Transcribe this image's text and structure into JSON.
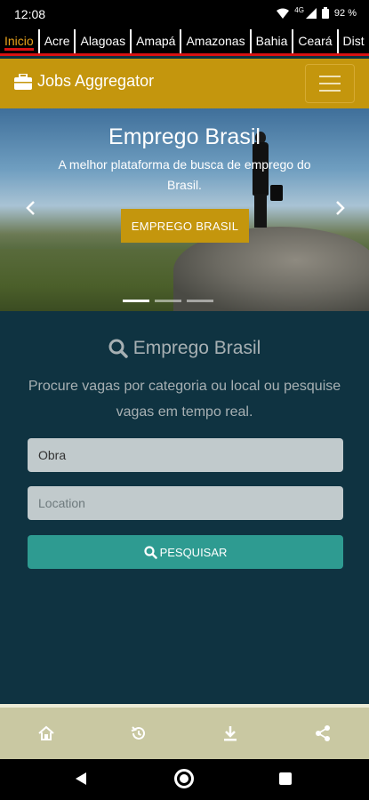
{
  "status_bar": {
    "time": "12:08",
    "network": "4G",
    "battery": "92 %"
  },
  "tabs": [
    {
      "label": "Inicio",
      "active": true
    },
    {
      "label": "Acre",
      "active": false
    },
    {
      "label": "Alagoas",
      "active": false
    },
    {
      "label": "Amapá",
      "active": false
    },
    {
      "label": "Amazonas",
      "active": false
    },
    {
      "label": "Bahia",
      "active": false
    },
    {
      "label": "Ceará",
      "active": false
    },
    {
      "label": "Dist",
      "active": false
    }
  ],
  "navbar": {
    "brand": "Jobs Aggregator",
    "menu_icon": "hamburger-icon"
  },
  "hero": {
    "title": "Emprego Brasil",
    "subtitle": "A melhor plataforma de busca de emprego do Brasil.",
    "cta_label": "EMPREGO BRASIL",
    "slide_count": 3,
    "active_slide": 1
  },
  "search": {
    "title": "Emprego Brasil",
    "description": "Procure vagas por categoria ou local ou pesquise vagas em tempo real.",
    "job_value": "Obra",
    "location_placeholder": "Location",
    "button_label": "PESQUISAR"
  },
  "app_bar": {
    "items": [
      "home-icon",
      "history-icon",
      "download-icon",
      "share-icon"
    ]
  },
  "colors": {
    "accent": "#c4960d",
    "background": "#0f3341",
    "button": "#2e9b91",
    "tab_active": "#e8a21c",
    "tab_underline": "#d81212",
    "app_bar": "#c9c8a2"
  }
}
